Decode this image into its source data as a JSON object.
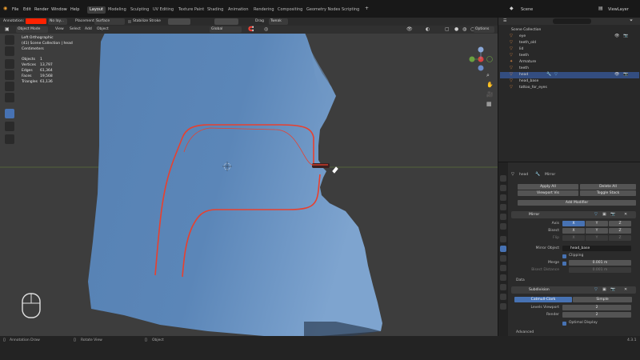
{
  "menu": [
    "File",
    "Edit",
    "Render",
    "Window",
    "Help"
  ],
  "workspaces": [
    "Layout",
    "Modeling",
    "Sculpting",
    "UV Editing",
    "Texture Paint",
    "Shading",
    "Animation",
    "Rendering",
    "Compositing",
    "Geometry Nodes",
    "Scripting"
  ],
  "active_workspace": "Layout",
  "scene": "Scene",
  "view_layer": "ViewLayer",
  "header": {
    "annotation_label": "Annotation:",
    "mode": "Object Mode",
    "view": "View",
    "select": "Select",
    "add": "Add",
    "object": "Object",
    "no_layer": "No lay...",
    "placement_label": "Placement:",
    "placement_value": "Surface",
    "stabilize": "Stabilize Stroke",
    "transform": "Global",
    "options": "Options",
    "gizmo_labels": [
      "Drag",
      "Tweak"
    ]
  },
  "viewport_info": {
    "view": "Left Orthographic",
    "collection": "(41) Scene Collection | head",
    "units": "Centimeters",
    "stats": [
      {
        "label": "Objects",
        "value": "1"
      },
      {
        "label": "Vertices",
        "value": "13,797"
      },
      {
        "label": "Edges",
        "value": "61,364"
      },
      {
        "label": "Faces",
        "value": "19,568"
      },
      {
        "label": "Triangles",
        "value": "61,136"
      }
    ]
  },
  "outliner": {
    "title": "Scene Collection",
    "search_placeholder": "",
    "items": [
      "eye",
      "teeth_old",
      "lid",
      "teeth",
      "Armature",
      "teeth",
      "head",
      "head_base",
      "tattoo_for_eyes"
    ],
    "selected_index": 6
  },
  "properties": {
    "object": "head",
    "modifier_name": "Mirror",
    "apply_all": "Apply All",
    "delete_all": "Delete All",
    "viewport_vis": "Viewport Vis",
    "toggle_stack": "Toggle Stack",
    "add_modifier": "Add Modifier",
    "mirror": {
      "name": "Mirror",
      "axis_label": "Axis",
      "bisect_label": "Bisect",
      "flip_label": "Flip",
      "axes": [
        "X",
        "Y",
        "Z"
      ],
      "mirror_object_label": "Mirror Object",
      "mirror_object": "head_base",
      "clipping": "Clipping",
      "merge_label": "Merge",
      "merge_value": "0.001 m",
      "bisect_distance_label": "Bisect Distance",
      "bisect_distance": "0.001 m",
      "data_label": "Data"
    },
    "subdivision": {
      "name": "Subdivision",
      "catmull": "Catmull-Clark",
      "simple": "Simple",
      "levels_viewport_label": "Levels Viewport",
      "levels_viewport": "2",
      "render_label": "Render",
      "render": "2",
      "optimal_display": "Optimal Display",
      "advanced": "Advanced"
    }
  },
  "status": [
    "Annotation Draw",
    "Rotate View",
    "Object"
  ],
  "version": "4.3.1",
  "colors": {
    "accent": "#4772b3",
    "mesh": "#5b85b5",
    "stroke": "#e8402e",
    "annotation": "#ff2200"
  }
}
